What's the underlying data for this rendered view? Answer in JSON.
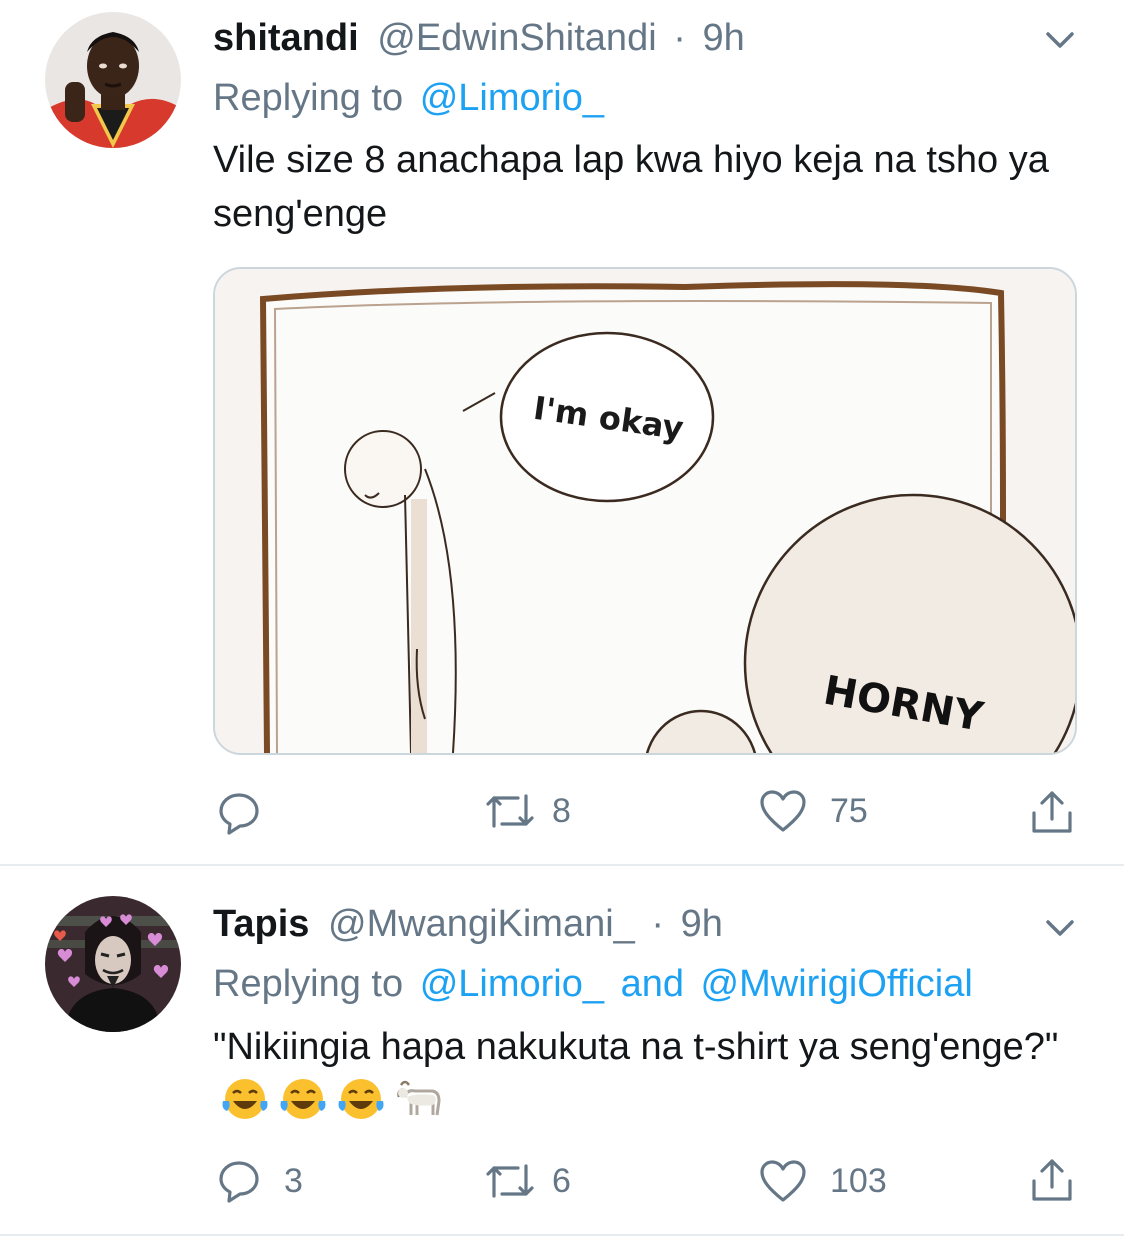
{
  "tweets": [
    {
      "display_name": "shitandi",
      "handle": "@EdwinShitandi",
      "separator": "·",
      "time": "9h",
      "replying_label": "Replying to",
      "replying_to": "@Limorio_",
      "replying_and": "",
      "replying_to_2": "",
      "text": "Vile size 8 anachapa lap kwa hiyo keja na tsho ya seng'enge",
      "media": {
        "bubble_small_text": "I'm okay",
        "bubble_large_text": "HORNY"
      },
      "actions": {
        "reply_count": "",
        "retweet_count": "8",
        "like_count": "75"
      },
      "colors": {
        "avatar_shirt": "#d73a2c",
        "media_frame": "#7a4a24"
      }
    },
    {
      "display_name": "Tapis",
      "handle": "@MwangiKimani_",
      "separator": "·",
      "time": "9h",
      "replying_label": "Replying to",
      "replying_to": "@Limorio_",
      "replying_and": "and",
      "replying_to_2": "@MwirigiOfficial",
      "text": "\"Nikiingia hapa nakukuta na t-shirt ya seng'enge?\"",
      "emojis": [
        "face-with-tears-of-joy",
        "face-with-tears-of-joy",
        "face-with-tears-of-joy",
        "goat"
      ],
      "actions": {
        "reply_count": "3",
        "retweet_count": "6",
        "like_count": "103"
      },
      "colors": {
        "avatar_bg": "#3a2a30",
        "hearts": "#d98cd6"
      }
    }
  ],
  "theme": {
    "link": "#1da1f2",
    "muted": "#657786",
    "text": "#14171a",
    "divider": "#e6ecf0"
  },
  "icons": [
    "chevron-down-icon",
    "reply-icon",
    "retweet-icon",
    "like-icon",
    "share-icon"
  ]
}
